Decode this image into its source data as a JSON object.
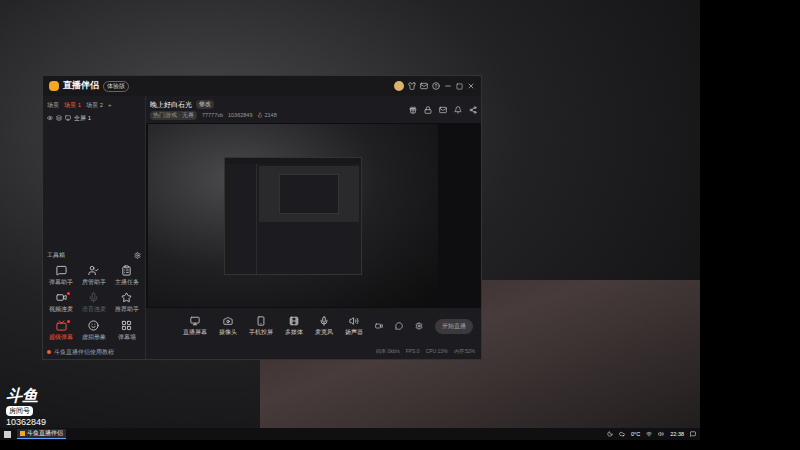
{
  "desktop": {
    "watermark": {
      "logo": "斗鱼",
      "label": "房间号",
      "room": "10362849"
    }
  },
  "window": {
    "title": "直播伴侣",
    "version": "体验版"
  },
  "scene_tabs": [
    {
      "label": "场景",
      "selected": false
    },
    {
      "label": "场景 1",
      "selected": true
    },
    {
      "label": "场景 2",
      "selected": false
    },
    {
      "label": "+",
      "selected": false
    }
  ],
  "sources": [
    {
      "label": "全屏 1",
      "visible": true
    }
  ],
  "toolbox": {
    "title": "工具箱",
    "items": [
      {
        "label": "弹幕助手",
        "active": false,
        "disabled": false,
        "new": false
      },
      {
        "label": "房管助手",
        "active": false,
        "disabled": false,
        "new": false
      },
      {
        "label": "主播任务",
        "active": false,
        "disabled": false,
        "new": false
      },
      {
        "label": "视频连麦",
        "active": false,
        "disabled": false,
        "new": true
      },
      {
        "label": "语音连麦",
        "active": false,
        "disabled": true,
        "new": false
      },
      {
        "label": "推荐助手",
        "active": false,
        "disabled": false,
        "new": false
      },
      {
        "label": "超级弹幕",
        "active": true,
        "disabled": false,
        "new": true
      },
      {
        "label": "虚拟形象",
        "active": false,
        "disabled": false,
        "new": false
      },
      {
        "label": "弹幕墙",
        "active": false,
        "disabled": false,
        "new": false
      }
    ]
  },
  "notice": "斗鱼直播伴侣使用教程",
  "room": {
    "title": "晚上好白石光",
    "edit": "修改",
    "category": "热门游戏 · 无畏",
    "income": "77777vb",
    "room_id": "10362849",
    "heat": "2148"
  },
  "controls": [
    "直播屏幕",
    "摄像头",
    "手机投屏",
    "多媒体",
    "麦克风",
    "扬声器"
  ],
  "start_button": "开始直播",
  "status": [
    "码率:0kb/s",
    "FPS:0",
    "CPU:13%",
    "内存:52%"
  ],
  "taskbar": {
    "apps": [
      {
        "label": "斗鱼直播伴侣",
        "selected": true
      }
    ],
    "weather": "0°C",
    "time": "22:38"
  }
}
